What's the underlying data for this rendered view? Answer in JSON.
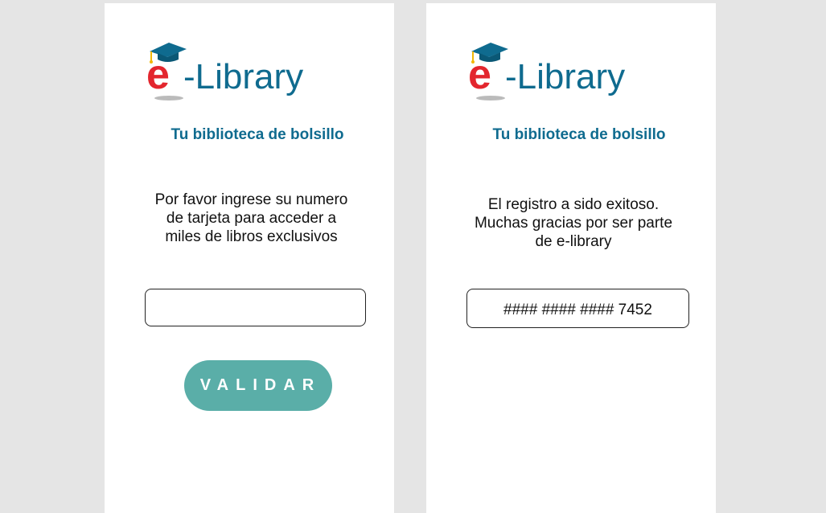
{
  "colors": {
    "background": "#e5e5e5",
    "tagline": "#0f6b8f",
    "button": "#5aaea8",
    "logo_e": "#e3262e",
    "logo_text": "#0f6b8f"
  },
  "brand": {
    "logo_letter": "e",
    "logo_text": "-Library"
  },
  "left_screen": {
    "tagline": "Tu biblioteca de bolsillo",
    "message": "Por favor ingrese su numero de tarjeta para acceder a miles de libros exclusivos",
    "card_input_value": "",
    "validate_label": "VALIDAR"
  },
  "right_screen": {
    "tagline": "Tu biblioteca de bolsillo",
    "message": "El registro a sido exitoso. Muchas gracias por ser parte de e-library",
    "card_number": "#### #### #### 7452"
  }
}
